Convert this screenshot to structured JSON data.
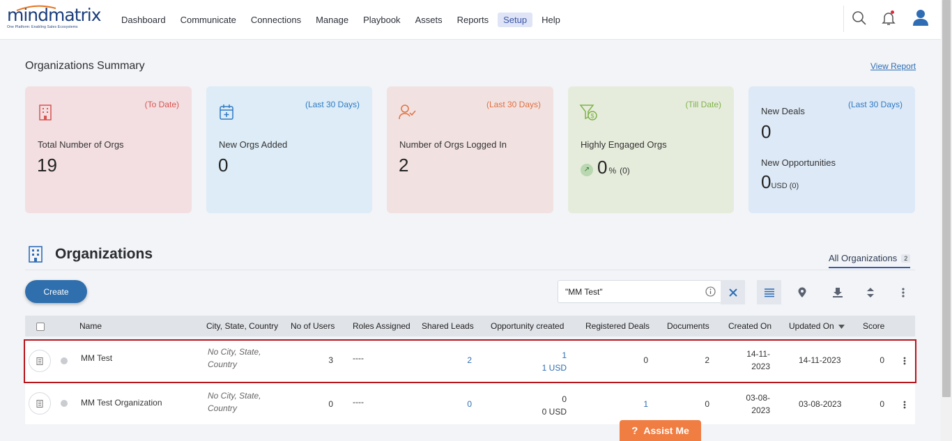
{
  "brand": {
    "name": "mindmatrix",
    "tagline": "One Platform: Enabling Sales Ecosystems"
  },
  "nav": [
    "Dashboard",
    "Communicate",
    "Connections",
    "Manage",
    "Playbook",
    "Assets",
    "Reports",
    "Setup",
    "Help"
  ],
  "nav_active": "Setup",
  "summary": {
    "title": "Organizations Summary",
    "view_report": "View Report",
    "cards": [
      {
        "period": "(To Date)",
        "label": "Total Number of Orgs",
        "value": "19",
        "period_color": "#d9534f"
      },
      {
        "period": "(Last 30 Days)",
        "label": "New Orgs Added",
        "value": "0",
        "period_color": "#2e7ac4"
      },
      {
        "period": "(Last 30 Days)",
        "label": "Number of Orgs Logged In",
        "value": "2",
        "period_color": "#e07040"
      },
      {
        "period": "(Till Date)",
        "label": "Highly Engaged Orgs",
        "value": "0",
        "unit": "%",
        "count": "(0)",
        "period_color": "#7fb24a"
      },
      {
        "period": "(Last 30 Days)",
        "deals_label": "New Deals",
        "deals_value": "0",
        "opp_label": "New Opportunities",
        "opp_value": "0",
        "opp_unit": "USD",
        "opp_count": "(0)",
        "period_color": "#2e7ac4"
      }
    ]
  },
  "orgs": {
    "title": "Organizations",
    "all_label": "All Organizations",
    "all_count": "2",
    "create_label": "Create",
    "search_value": "\"MM Test\""
  },
  "table": {
    "headers": [
      "Name",
      "City, State, Country",
      "No of Users",
      "Roles Assigned",
      "Shared Leads",
      "Opportunity created",
      "Registered Deals",
      "Documents",
      "Created On",
      "Updated On",
      "Score"
    ],
    "rows": [
      {
        "name": "MM Test",
        "loc1": "No City, State,",
        "loc2": "Country",
        "users": "3",
        "roles": "----",
        "leads": "2",
        "opp": "1",
        "opp_usd": "1 USD",
        "deals": "0",
        "docs": "2",
        "created1": "14-11-",
        "created2": "2023",
        "updated": "14-11-2023",
        "score": "0"
      },
      {
        "name": "MM Test Organization",
        "loc1": "No City, State,",
        "loc2": "Country",
        "users": "0",
        "roles": "----",
        "leads": "0",
        "opp": "0",
        "opp_usd": "0 USD",
        "deals": "1",
        "docs": "0",
        "created1": "03-08-",
        "created2": "2023",
        "updated": "03-08-2023",
        "score": "0"
      }
    ]
  },
  "assist": {
    "label": "Assist Me",
    "glyph": "?"
  },
  "icons": {
    "search": "search-icon",
    "bell": "bell-icon",
    "user": "user-icon",
    "card1": "building-icon",
    "card2": "calendar-plus-icon",
    "card3": "user-check-icon",
    "card4": "funnel-dollar-icon",
    "info": "info-icon",
    "clear": "close-icon",
    "list": "list-view-icon",
    "map": "map-pin-icon",
    "download": "download-icon",
    "sort": "sort-icon",
    "more": "kebab-icon"
  }
}
